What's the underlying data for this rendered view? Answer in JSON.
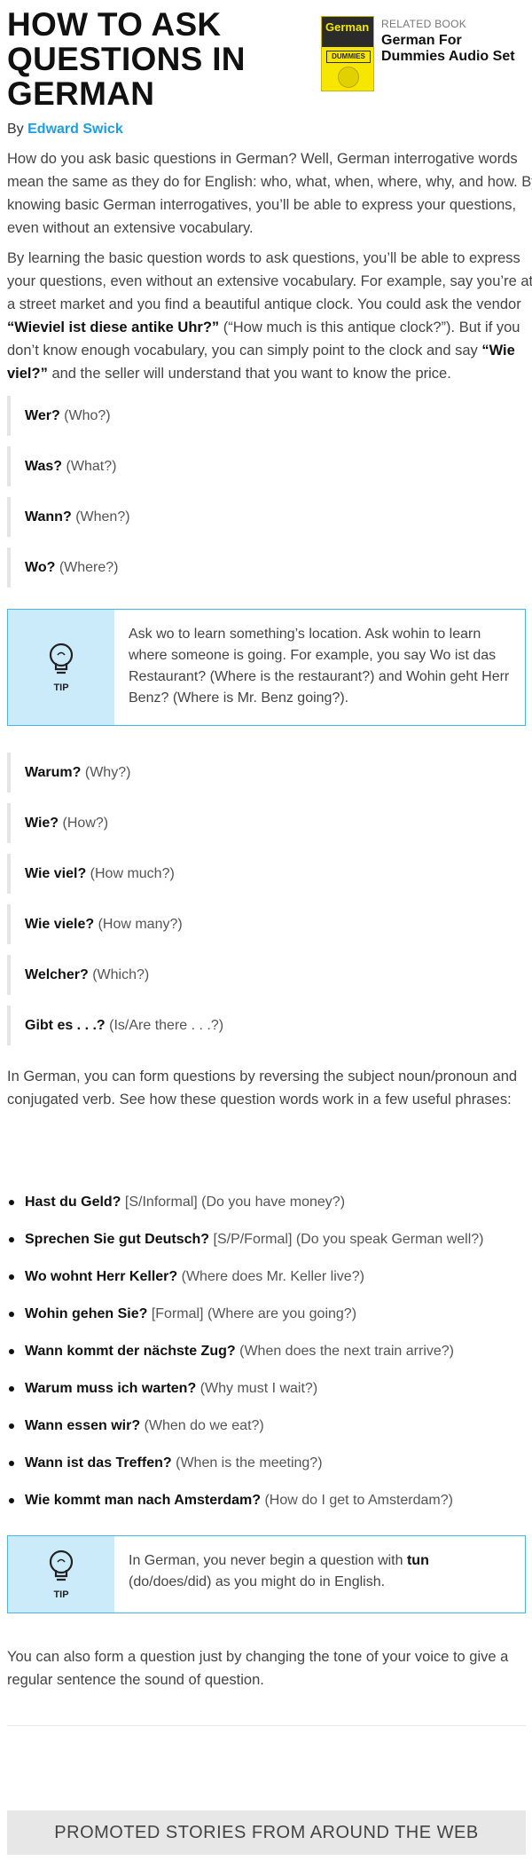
{
  "article": {
    "title": "HOW TO ASK QUESTIONS IN GERMAN",
    "byline_prefix": "By",
    "author": "Edward Swick"
  },
  "related_book": {
    "label": "RELATED BOOK",
    "title": "German For Dummies Audio Set",
    "cover_word": "German",
    "cover_brand": "DUMMIES"
  },
  "intro": [
    "How do you ask basic questions in German? Well, German interrogative words mean the same as they do for English: who, what, when, where, why, and how. By knowing basic German interrogatives, you’ll be able to express your questions, even without an extensive vocabulary."
  ],
  "p2": {
    "a": "By learning the basic question words to ask questions, you’ll be able to express your questions, even without an extensive vocabulary. For example, say you’re at a street market and you find a beautiful antique clock. You could ask the vendor ",
    "b": "“Wieviel ist diese antike Uhr?”",
    "c": " (“How much is this antique clock?”). But if you don’t know enough vocabulary, you can simply point to the clock and say ",
    "d": "“Wie viel?”",
    "e": " and the seller will understand that you want to know the price."
  },
  "questions_a": [
    {
      "de": "Wer?",
      "en": "(Who?)"
    },
    {
      "de": "Was?",
      "en": "(What?)"
    },
    {
      "de": "Wann?",
      "en": "(When?)"
    },
    {
      "de": "Wo?",
      "en": "(Where?)"
    }
  ],
  "tip1": {
    "label": "TIP",
    "text": "Ask wo to learn something’s location. Ask wohin to learn where someone is going. For example, you say Wo ist das Restaurant? (Where is the restaurant?) and Wohin geht Herr Benz? (Where is Mr. Benz going?)."
  },
  "questions_b": [
    {
      "de": "Warum?",
      "en": "(Why?)"
    },
    {
      "de": "Wie?",
      "en": "(How?)"
    },
    {
      "de": "Wie viel?",
      "en": "(How much?)"
    },
    {
      "de": "Wie viele?",
      "en": "(How many?)"
    },
    {
      "de": "Welcher?",
      "en": "(Which?)"
    },
    {
      "de": "Gibt es . . .?",
      "en": "(Is/Are there . . .?)"
    }
  ],
  "p3": "In German, you can form questions by reversing the subject noun/pronoun and conjugated verb. See how these question words work in a few useful phrases:",
  "phrases": [
    {
      "de": "Hast du Geld?",
      "en": "[S/Informal] (Do you have money?)"
    },
    {
      "de": "Sprechen Sie gut Deutsch?",
      "en": "[S/P/Formal] (Do you speak German well?)"
    },
    {
      "de": "Wo wohnt Herr Keller?",
      "en": "(Where does Mr. Keller live?)"
    },
    {
      "de": "Wohin gehen Sie?",
      "en": "[Formal] (Where are you going?)"
    },
    {
      "de": "Wann kommt der nächste Zug?",
      "en": "(When does the next train arrive?)"
    },
    {
      "de": "Warum muss ich warten?",
      "en": "(Why must I wait?)"
    },
    {
      "de": "Wann essen wir?",
      "en": "(When do we eat?)"
    },
    {
      "de": "Wann ist das Treffen?",
      "en": "(When is the meeting?)"
    },
    {
      "de": "Wie kommt man nach Amsterdam?",
      "en": "(How do I get to Amsterdam?)"
    }
  ],
  "tip2": {
    "label": "TIP",
    "a": "In German, you never begin a question with ",
    "b": "tun",
    "c": " (do/does/did) as you might do in English."
  },
  "p4": "You can also form a question just by changing the tone of your voice to give a regular sentence the sound of question.",
  "promoted": "PROMOTED STORIES FROM AROUND THE WEB",
  "colors": {
    "author_link": "#1e9de0",
    "tip_border": "#49b6e8",
    "tip_side": "#ccebfa"
  }
}
